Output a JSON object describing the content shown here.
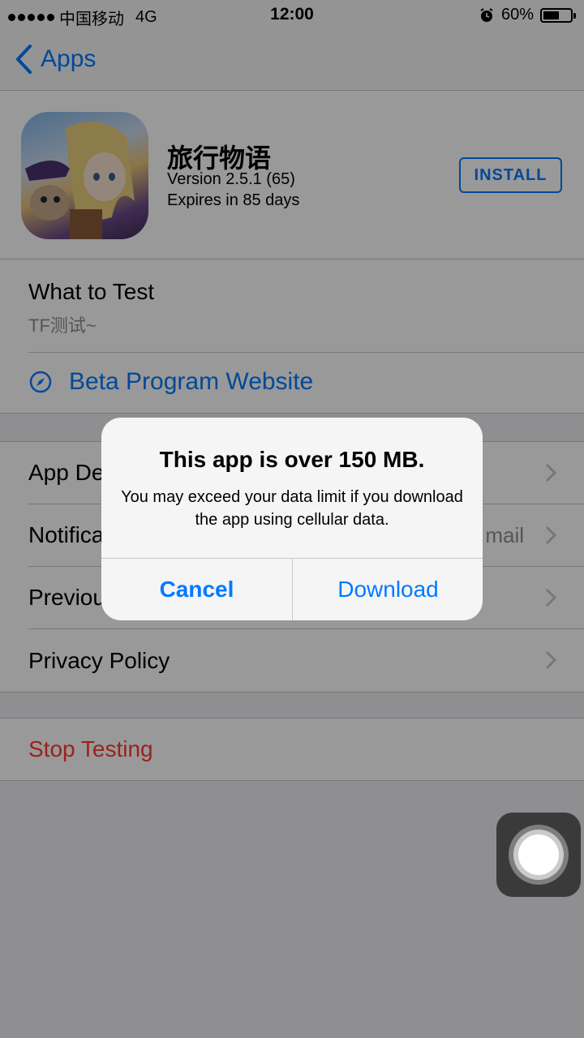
{
  "status_bar": {
    "carrier": "中国移动",
    "network": "4G",
    "time": "12:00",
    "battery": "60%",
    "battery_level": 0.6
  },
  "nav": {
    "back_label": "Apps"
  },
  "app": {
    "name": "旅行物语",
    "version": "Version 2.5.1 (65)",
    "expires": "Expires in 85 days",
    "install_label": "INSTALL"
  },
  "what_to_test": {
    "title": "What to Test",
    "description": "TF测试~",
    "beta_link": "Beta Program Website"
  },
  "menu": {
    "items": [
      {
        "label": "App De"
      },
      {
        "label": "Notifica",
        "detail": "mail"
      },
      {
        "label": "Previou"
      },
      {
        "label": "Privacy Policy"
      }
    ]
  },
  "stop": {
    "label": "Stop Testing"
  },
  "alert": {
    "title": "This app is over 150 MB.",
    "message": "You may exceed your data limit if you download the app using cellular data.",
    "cancel_label": "Cancel",
    "download_label": "Download"
  },
  "colors": {
    "accent": "#007aff",
    "destructive": "#ff3b30"
  }
}
